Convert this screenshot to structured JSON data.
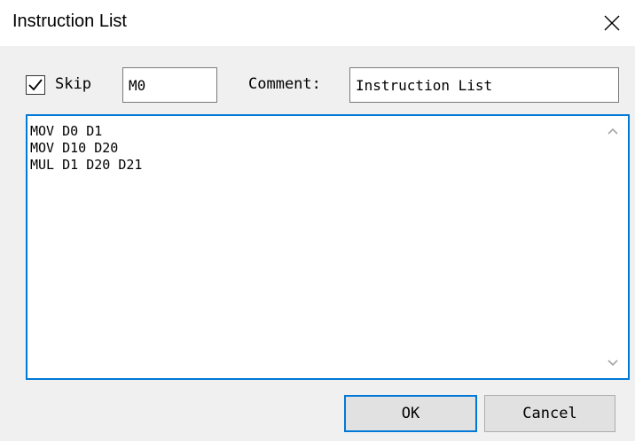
{
  "window": {
    "title": "Instruction List"
  },
  "options": {
    "skip_checked": true,
    "skip_label": "Skip",
    "skip_value": "M0",
    "comment_label": "Comment:",
    "comment_value": "Instruction List"
  },
  "editor": {
    "lines": [
      "MOV D0 D1",
      "MOV D10 D20",
      "MUL D1 D20 D21"
    ]
  },
  "buttons": {
    "ok_label": "OK",
    "cancel_label": "Cancel"
  },
  "icons": {
    "close": "close-icon",
    "check": "checkmark-icon",
    "scroll_up": "chevron-up-icon",
    "scroll_down": "chevron-down-icon"
  },
  "colors": {
    "accent": "#0078d7",
    "dialog_bg": "#f0f0f0",
    "button_bg": "#e1e1e1"
  }
}
